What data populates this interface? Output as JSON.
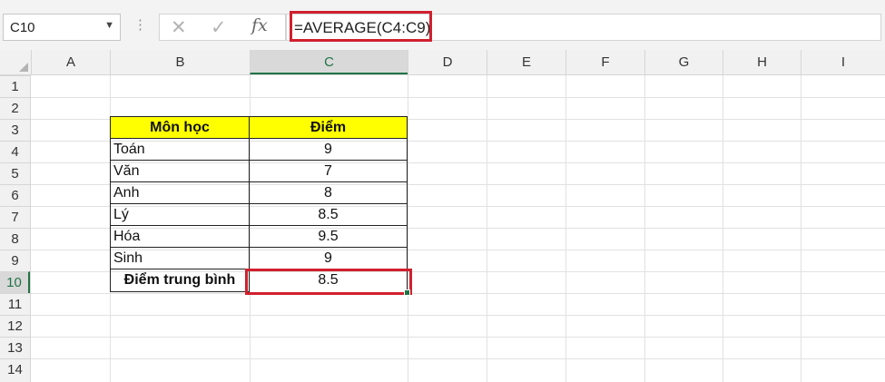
{
  "formula_bar": {
    "name_box": "C10",
    "formula": "=AVERAGE(C4:C9)",
    "cancel_icon": "✕",
    "enter_icon": "✓",
    "fx_label": "fx"
  },
  "columns": [
    "A",
    "B",
    "C",
    "D",
    "E",
    "F",
    "G",
    "H",
    "I"
  ],
  "rows": [
    "1",
    "2",
    "3",
    "4",
    "5",
    "6",
    "7",
    "8",
    "9",
    "10",
    "11",
    "12",
    "13",
    "14"
  ],
  "selected_cell": {
    "column": "C",
    "row": "10"
  },
  "table": {
    "header": {
      "subject": "Môn học",
      "score": "Điểm"
    },
    "rows": [
      {
        "subject": "Toán",
        "score": "9"
      },
      {
        "subject": "Văn",
        "score": "7"
      },
      {
        "subject": "Anh",
        "score": "8"
      },
      {
        "subject": "Lý",
        "score": "8.5"
      },
      {
        "subject": "Hóa",
        "score": "9.5"
      },
      {
        "subject": "Sinh",
        "score": "9"
      }
    ],
    "average": {
      "label": "Điểm trung bình",
      "value": "8.5"
    }
  },
  "colors": {
    "header_fill": "#ffff00",
    "highlight_border": "#d0202e",
    "selection_green": "#217346"
  }
}
